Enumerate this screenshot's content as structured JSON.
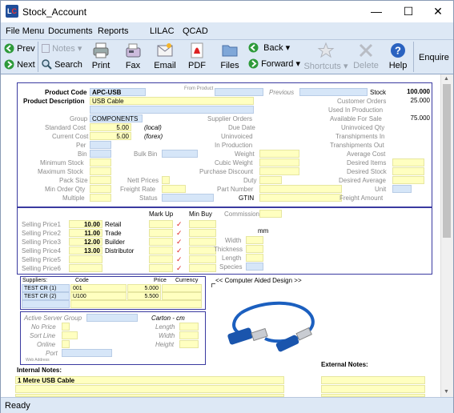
{
  "window": {
    "title": "Stock_Account"
  },
  "menu": [
    "File Menu",
    "Documents",
    "Reports",
    "LILAC",
    "QCAD"
  ],
  "toolbar": {
    "prev": "Prev",
    "next": "Next",
    "notes": "Notes",
    "search": "Search",
    "print": "Print",
    "fax": "Fax",
    "email": "Email",
    "pdf": "PDF",
    "files": "Files",
    "back": "Back",
    "forward": "Forward",
    "shortcuts": "Shortcuts",
    "delete": "Delete",
    "help": "Help",
    "enquire": "Enquire"
  },
  "header": {
    "product_code_label": "Product Code",
    "product_code": "APC-USB",
    "from_product_label": "From Product",
    "previous_label": "Previous",
    "stock_label": "Stock",
    "stock": "100.000",
    "description_label": "Product Description",
    "description": "USB Cable",
    "customer_orders_label": "Customer Orders",
    "customer_orders": "25.000",
    "used_in_production_label": "Used In Production",
    "group_label": "Group",
    "group": "COMPONENTS",
    "supplier_orders_label": "Supplier Orders",
    "available_label": "Available For Sale",
    "available": "75.000",
    "standard_cost_label": "Standard Cost",
    "standard_cost": "5.00",
    "local": "(local)",
    "due_date_label": "Due Date",
    "uninvoiced_qty_label": "Uninvoiced Qty",
    "current_cost_label": "Current Cost",
    "current_cost": "5.00",
    "forex": "(forex)",
    "uninvoiced_label": "Uninvoiced",
    "transhipments_in_label": "Transhipments In",
    "per_label": "Per",
    "in_production_label": "In Production",
    "transhipments_out_label": "Transhipments Out",
    "bin_label": "Bin",
    "bulk_bin_label": "Bulk Bin",
    "weight_label": "Weight",
    "average_cost_label": "Average Cost",
    "min_stock_label": "Minimum Stock",
    "cubic_weight_label": "Cubic Weight",
    "desired_items_label": "Desired Items",
    "max_stock_label": "Maximum Stock",
    "purchase_discount_label": "Purchase Discount",
    "desired_stock_label": "Desired Stock",
    "pack_size_label": "Pack Size",
    "nett_prices_label": "Nett Prices",
    "duty_label": "Duty",
    "desired_average_label": "Desired Average",
    "min_order_label": "Min Order Qty",
    "freight_rate_label": "Freight Rate",
    "part_number_label": "Part Number",
    "unit_label": "Unit",
    "multiple_label": "Multiple",
    "status_label": "Status",
    "gtin_label": "GTIN",
    "freight_amount_label": "Freight Amount"
  },
  "pricing": {
    "markup_label": "Mark Up",
    "minbuy_label": "Min Buy",
    "commission_label": "Commission",
    "rows": [
      {
        "label": "Selling Price1",
        "value": "10.00",
        "name": "Retail"
      },
      {
        "label": "Selling Price2",
        "value": "11.00",
        "name": "Trade"
      },
      {
        "label": "Selling Price3",
        "value": "12.00",
        "name": "Builder"
      },
      {
        "label": "Selling Price4",
        "value": "13.00",
        "name": "Distributor"
      },
      {
        "label": "Selling Price5",
        "value": "",
        "name": ""
      },
      {
        "label": "Selling Price6",
        "value": "",
        "name": ""
      }
    ],
    "mm_label": "mm",
    "width_label": "Width",
    "thickness_label": "Thickness",
    "length_label": "Length",
    "species_label": "Species"
  },
  "suppliers": {
    "headers": [
      "Suppliers:",
      "Code",
      "Price",
      "Currency"
    ],
    "rows": [
      {
        "supplier": "TEST CR (1)",
        "code": "001",
        "price": "5.000",
        "currency": ""
      },
      {
        "supplier": "TEST CR (2)",
        "code": "U100",
        "price": "5.500",
        "currency": ""
      }
    ]
  },
  "cad": {
    "label": "<< Computer Aided Design >>"
  },
  "web": {
    "group_label": "Active Server Group",
    "no_price_label": "No Price",
    "sort_line_label": "Sort Line",
    "online_label": "Online",
    "port_label": "Port",
    "web_address_label": "Web Address",
    "carton_label": "Carton - cm",
    "length_label": "Length",
    "width_label": "Width",
    "height_label": "Height"
  },
  "notes": {
    "internal_label": "Internal Notes:",
    "internal_text": "1 Metre USB Cable",
    "external_label": "External Notes:"
  },
  "status": {
    "text": "Ready"
  },
  "colors": {
    "accent": "#3a3aa0",
    "field_yellow": "#ffffc0",
    "field_blue": "#d6e6f8",
    "toolbar_bg": "#dde8f5"
  }
}
